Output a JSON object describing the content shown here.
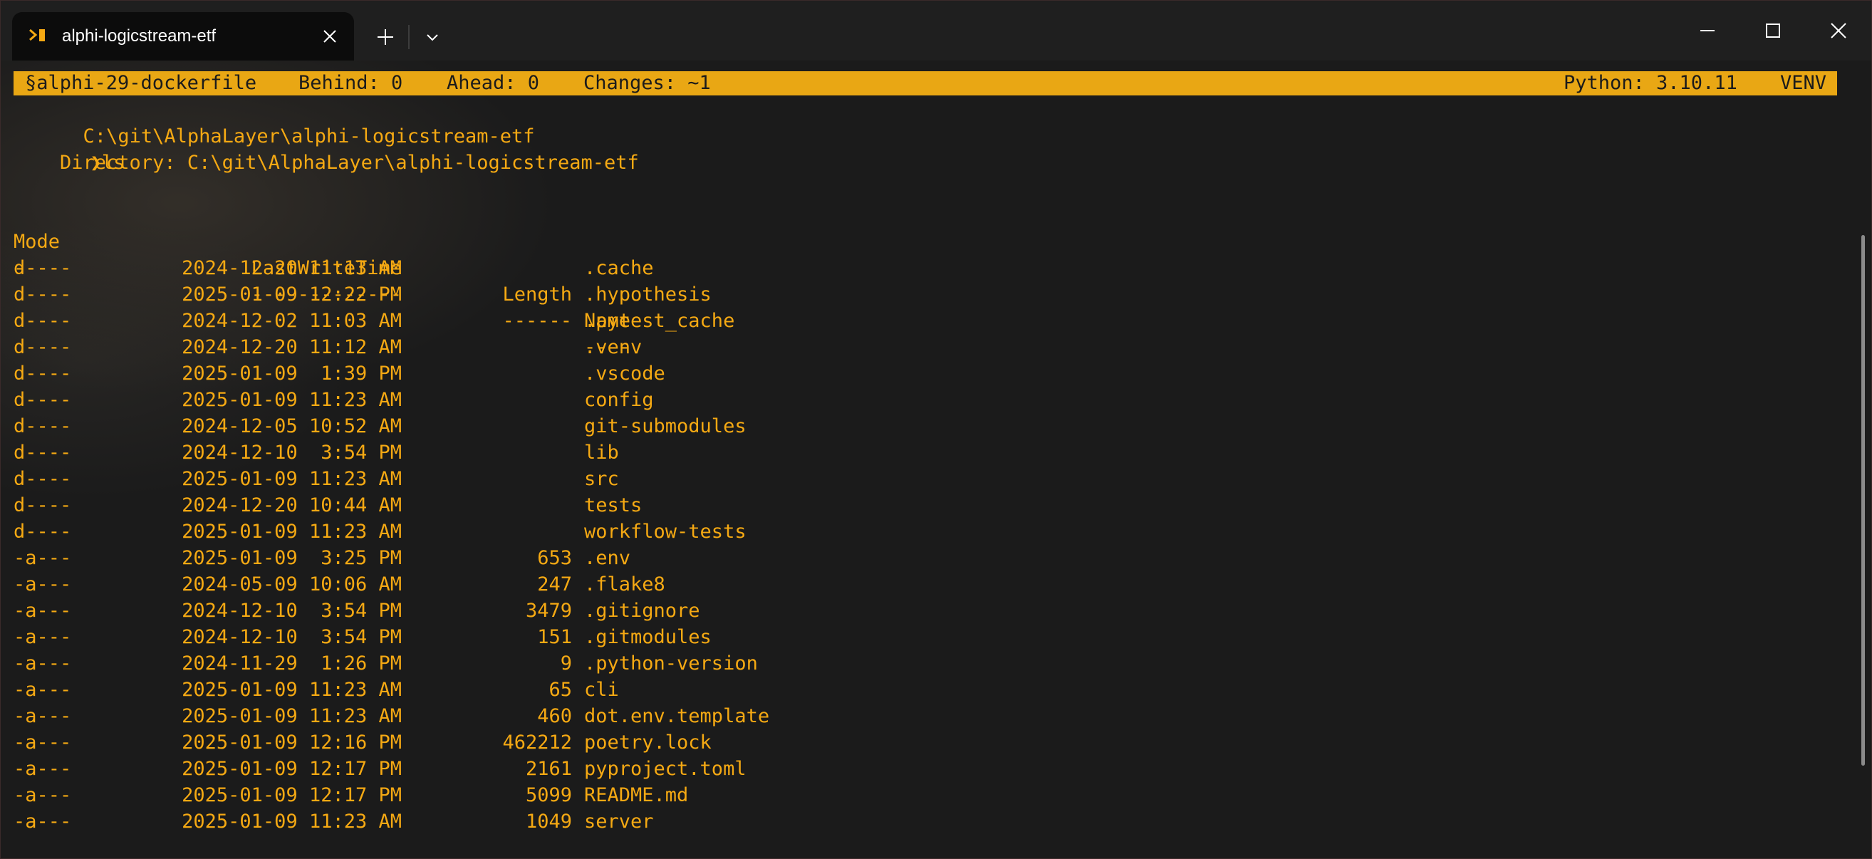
{
  "window": {
    "tab_title": "alphi-logicstream-etf"
  },
  "statusbar": {
    "branch": "§alphi-29-dockerfile",
    "behind": "Behind: 0",
    "ahead": "Ahead: 0",
    "changes": "Changes: ~1",
    "python": "Python: 3.10.11",
    "venv": "VENV"
  },
  "prompt": {
    "path": "C:\\git\\AlphaLayer\\alphi-logicstream-etf",
    "symbol": "❯",
    "command": "ls"
  },
  "listing": {
    "directory_line": "    Directory: C:\\git\\AlphaLayer\\alphi-logicstream-etf",
    "headers": {
      "mode": "Mode",
      "time": "LastWriteTime",
      "length": "Length",
      "name": "Name"
    },
    "underlines": {
      "mode": "----",
      "time": "-------------",
      "length": "------",
      "name": "----"
    },
    "rows": [
      {
        "mode": "d----",
        "time": "2024-12-20 11:13 AM",
        "length": "",
        "name": ".cache"
      },
      {
        "mode": "d----",
        "time": "2025-01-09 12:22 PM",
        "length": "",
        "name": ".hypothesis"
      },
      {
        "mode": "d----",
        "time": "2024-12-02 11:03 AM",
        "length": "",
        "name": ".pytest_cache"
      },
      {
        "mode": "d----",
        "time": "2024-12-20 11:12 AM",
        "length": "",
        "name": ".venv"
      },
      {
        "mode": "d----",
        "time": "2025-01-09  1:39 PM",
        "length": "",
        "name": ".vscode"
      },
      {
        "mode": "d----",
        "time": "2025-01-09 11:23 AM",
        "length": "",
        "name": "config"
      },
      {
        "mode": "d----",
        "time": "2024-12-05 10:52 AM",
        "length": "",
        "name": "git-submodules"
      },
      {
        "mode": "d----",
        "time": "2024-12-10  3:54 PM",
        "length": "",
        "name": "lib"
      },
      {
        "mode": "d----",
        "time": "2025-01-09 11:23 AM",
        "length": "",
        "name": "src"
      },
      {
        "mode": "d----",
        "time": "2024-12-20 10:44 AM",
        "length": "",
        "name": "tests"
      },
      {
        "mode": "d----",
        "time": "2025-01-09 11:23 AM",
        "length": "",
        "name": "workflow-tests"
      },
      {
        "mode": "-a---",
        "time": "2025-01-09  3:25 PM",
        "length": "653",
        "name": ".env"
      },
      {
        "mode": "-a---",
        "time": "2024-05-09 10:06 AM",
        "length": "247",
        "name": ".flake8"
      },
      {
        "mode": "-a---",
        "time": "2024-12-10  3:54 PM",
        "length": "3479",
        "name": ".gitignore"
      },
      {
        "mode": "-a---",
        "time": "2024-12-10  3:54 PM",
        "length": "151",
        "name": ".gitmodules"
      },
      {
        "mode": "-a---",
        "time": "2024-11-29  1:26 PM",
        "length": "9",
        "name": ".python-version"
      },
      {
        "mode": "-a---",
        "time": "2025-01-09 11:23 AM",
        "length": "65",
        "name": "cli"
      },
      {
        "mode": "-a---",
        "time": "2025-01-09 11:23 AM",
        "length": "460",
        "name": "dot.env.template"
      },
      {
        "mode": "-a---",
        "time": "2025-01-09 12:16 PM",
        "length": "462212",
        "name": "poetry.lock"
      },
      {
        "mode": "-a---",
        "time": "2025-01-09 12:17 PM",
        "length": "2161",
        "name": "pyproject.toml"
      },
      {
        "mode": "-a---",
        "time": "2025-01-09 12:17 PM",
        "length": "5099",
        "name": "README.md"
      },
      {
        "mode": "-a---",
        "time": "2025-01-09 11:23 AM",
        "length": "1049",
        "name": "server"
      }
    ]
  },
  "colors": {
    "accent": "#e9a714",
    "text": "#f5a913",
    "background": "#1b1b1b"
  },
  "icons": {
    "tab": "terminal-icon",
    "close": "close-icon",
    "new_tab": "plus-icon",
    "dropdown": "chevron-down-icon",
    "minimize": "minimize-icon",
    "maximize": "maximize-icon",
    "window_close": "close-icon"
  }
}
